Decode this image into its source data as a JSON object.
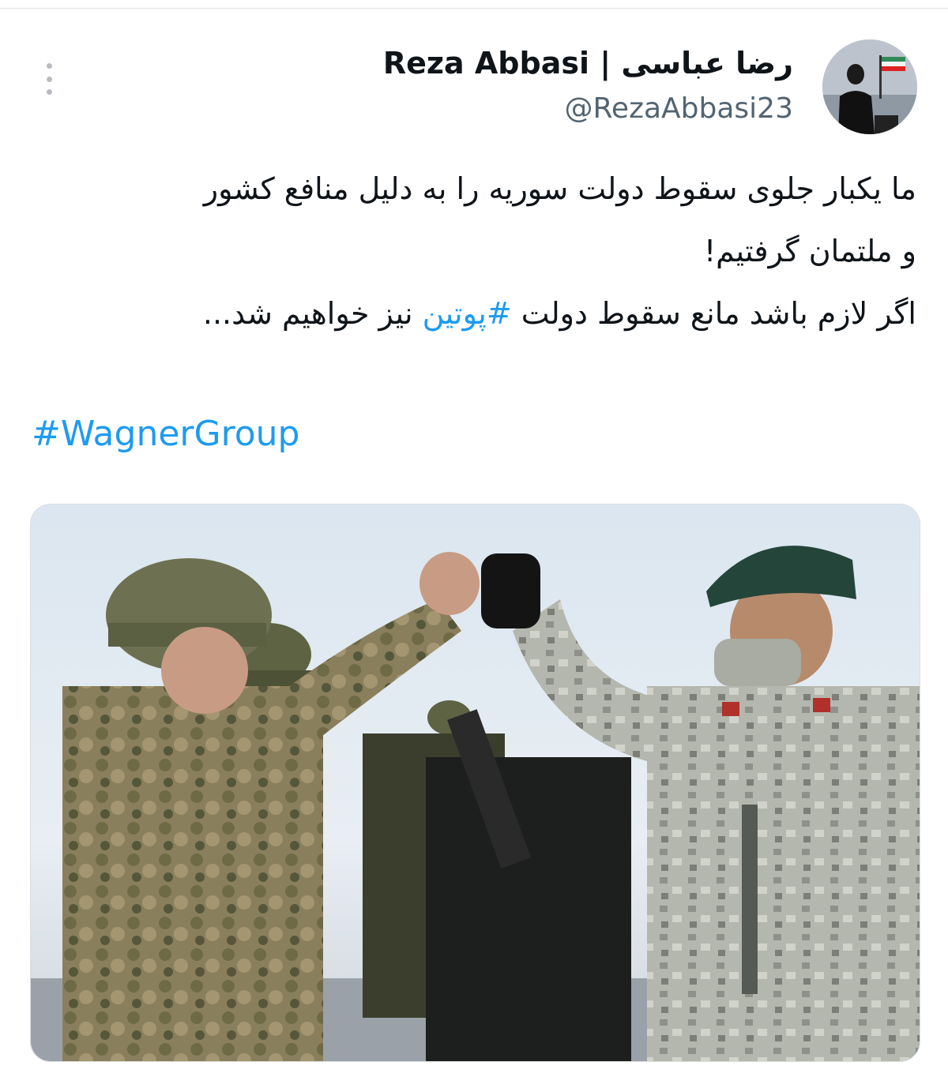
{
  "author": {
    "display_name": "Reza Abbasi | رضا عباسی",
    "handle": "@RezaAbbasi23"
  },
  "tweet": {
    "line1": "ما یکبار جلوی سقوط دولت سوریه را به دلیل منافع کشور",
    "line2": "و ملتمان گرفتیم!",
    "line3_before": "اگر لازم باشد مانع سقوط دولت ",
    "line3_hashtag": "#پوتین",
    "line3_after": " نیز خواهیم شد...",
    "hashtag": "#WagnerGroup"
  },
  "colors": {
    "link": "#1d9bf0",
    "text": "#0f1419",
    "muted": "#536471"
  },
  "icons": {
    "more": "vertical-ellipsis-icon"
  }
}
